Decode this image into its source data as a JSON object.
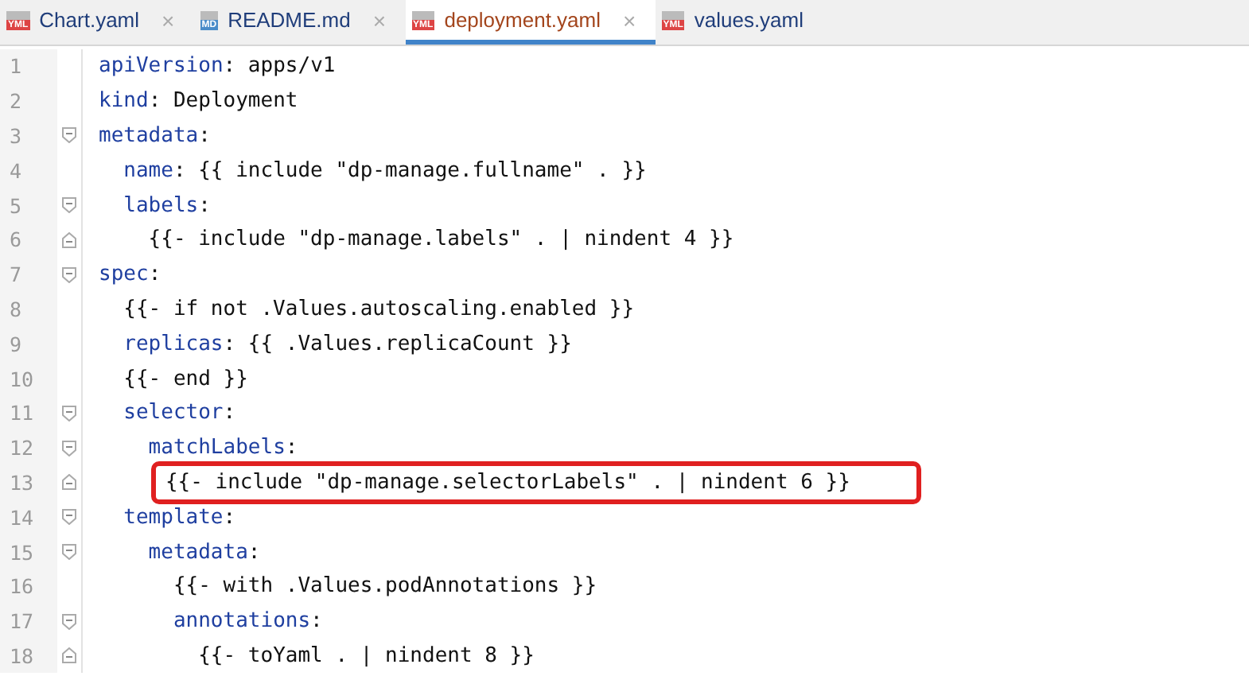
{
  "tabs": [
    {
      "badge": "YML",
      "kind": "yml",
      "label": "Chart.yaml",
      "close": "×",
      "selected": false
    },
    {
      "badge": "MD",
      "kind": "md",
      "label": "README.md",
      "close": "×",
      "selected": false
    },
    {
      "badge": "YML",
      "kind": "yml",
      "label": "deployment.yaml",
      "close": "×",
      "selected": true
    },
    {
      "badge": "YML",
      "kind": "yml",
      "label": "values.yaml",
      "selected": false
    }
  ],
  "lines": [
    {
      "number": "1",
      "key": "apiVersion",
      "text": ": apps/v1",
      "kind": "plain",
      "highlighted": false
    },
    {
      "number": "2",
      "key": "kind",
      "text": ": Deployment",
      "kind": "plain",
      "highlighted": false
    },
    {
      "number": "3",
      "key": "metadata",
      "text": ":",
      "kind": "fold_start",
      "highlighted": false,
      "children": [
        {
          "number": "4",
          "key": "name",
          "text": ": {{ include \"dp-manage.fullname\" . }}",
          "kind": "plain",
          "highlighted": false
        },
        {
          "number": "5",
          "key": "labels",
          "text": ":",
          "kind": "fold_start",
          "highlighted": false,
          "children": [
            {
              "number": "6",
              "text": "{{- include \"dp-manage.labels\" . | nindent 4 }}",
              "kind": "fold_end",
              "highlighted": false
            }
          ]
        }
      ]
    },
    {
      "number": "7",
      "key": "spec",
      "text": ":",
      "kind": "fold_start",
      "highlighted": false,
      "children": [
        {
          "number": "8",
          "text": "{{- if not .Values.autoscaling.enabled }}",
          "kind": "plain",
          "highlighted": false
        },
        {
          "number": "9",
          "key": "replicas",
          "text": ": {{ .Values.replicaCount }}",
          "kind": "plain",
          "highlighted": false
        },
        {
          "number": "10",
          "text": "{{- end }}",
          "kind": "plain",
          "highlighted": false
        },
        {
          "number": "11",
          "key": "selector",
          "text": ":",
          "kind": "fold_start",
          "highlighted": false,
          "children": [
            {
              "number": "12",
              "key": "matchLabels",
              "text": ":",
              "kind": "fold_start",
              "highlighted": false,
              "children": [
                {
                  "number": "13",
                  "text": "{{- include \"dp-manage.selectorLabels\" . | nindent 6 }}",
                  "kind": "fold_end",
                  "highlighted": true
                }
              ]
            }
          ]
        },
        {
          "number": "14",
          "key": "template",
          "text": ":",
          "kind": "fold_start",
          "highlighted": false,
          "children": [
            {
              "number": "15",
              "key": "metadata",
              "text": ":",
              "kind": "fold_start",
              "highlighted": false,
              "children": [
                {
                  "number": "16",
                  "text": "{{- with .Values.podAnnotations }}",
                  "kind": "plain",
                  "highlighted": false
                },
                {
                  "number": "17",
                  "key": "annotations",
                  "text": ":",
                  "kind": "fold_start",
                  "highlighted": false,
                  "children": [
                    {
                      "number": "18",
                      "text": "{{- toYaml . | nindent 8 }}",
                      "kind": "fold_end",
                      "highlighted": false
                    }
                  ]
                }
              ]
            }
          ]
        }
      ]
    }
  ]
}
